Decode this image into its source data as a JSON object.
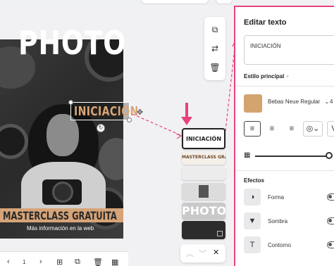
{
  "panel": {
    "title": "Editar texto",
    "text_value": "INICIACIÓN",
    "main_style_label": "Estilo principal",
    "main_style_add": "+",
    "font_name": "Bebas Neue Regular",
    "font_chevron": "⌄",
    "font_size": "4",
    "effects_label": "Efectos",
    "effects": [
      {
        "label": "Forma",
        "icon": "forma-icon"
      },
      {
        "label": "Sombra",
        "icon": "sombra-icon"
      },
      {
        "label": "Contorno",
        "icon": "contorno-icon"
      }
    ]
  },
  "poster": {
    "title": "PHOTO",
    "subtitle": "INICIACIÓN",
    "banner": "MASTERCLASS GRATUITA",
    "more_info": "Más información en la web"
  },
  "layers": {
    "iniciacion": "INICIACIÓN",
    "masterclass": "MASTERCLASS GRATUITA",
    "photo": "PHOTO"
  },
  "bottom_bar": {
    "page_number": "1"
  },
  "colors": {
    "accent": "#e8427d",
    "swatch": "#d4a470"
  }
}
